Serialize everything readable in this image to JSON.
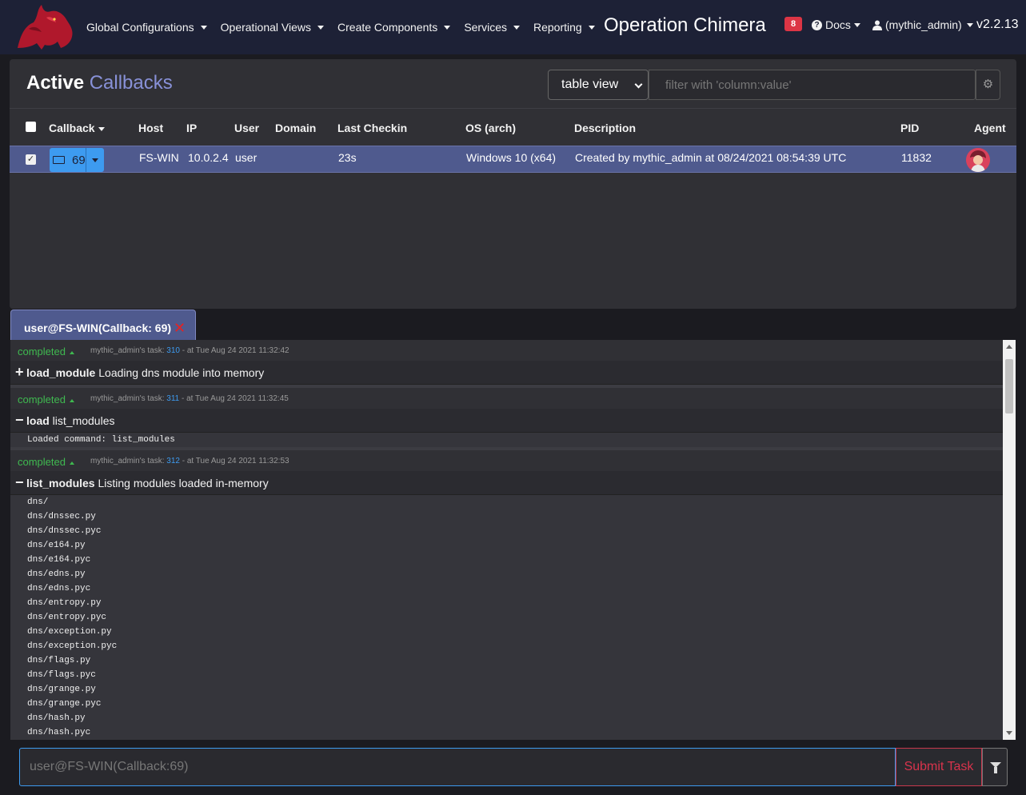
{
  "navbar": {
    "menus": [
      {
        "label": "Global Configurations",
        "name": "nav-global-configurations"
      },
      {
        "label": "Operational Views",
        "name": "nav-operational-views"
      },
      {
        "label": "Create Components",
        "name": "nav-create-components"
      },
      {
        "label": "Services",
        "name": "nav-services"
      },
      {
        "label": "Reporting",
        "name": "nav-reporting"
      }
    ],
    "operation_title": "Operation Chimera",
    "alert_count": "8",
    "docs_label": "Docs",
    "user_label": "(mythic_admin)",
    "version": "v2.2.13"
  },
  "callbacks": {
    "title_prefix": "Active ",
    "title_accent": "Callbacks",
    "view_select": "table view",
    "filter_placeholder": "filter with 'column:value'",
    "columns": [
      "Callback",
      "Host",
      "IP",
      "User",
      "Domain",
      "Last Checkin",
      "OS (arch)",
      "Description",
      "PID",
      "Agent"
    ],
    "rows": [
      {
        "callback_id": "69",
        "host": "FS-WIN",
        "ip": "10.0.2.4",
        "user": "user",
        "domain": "",
        "last_checkin": "23s",
        "os": "Windows 10 (x64)",
        "description": "Created by mythic_admin at 08/24/2021 08:54:39 UTC",
        "pid": "11832",
        "selected": true
      }
    ]
  },
  "tab": {
    "label": "user@FS-WIN(Callback: 69)",
    "close": "✕"
  },
  "tasks": [
    {
      "status": "completed",
      "meta_prefix": "mythic_admin's task: ",
      "task_id": "310",
      "meta_suffix": " - at Tue Aug 24 2021 11:32:42",
      "expand_sign": "+",
      "command": "load_module",
      "params": " Loading dns module into memory",
      "response": []
    },
    {
      "status": "completed",
      "meta_prefix": "mythic_admin's task: ",
      "task_id": "311",
      "meta_suffix": " - at Tue Aug 24 2021 11:32:45",
      "expand_sign": "−",
      "command": "load",
      "params": " list_modules",
      "response": [
        "Loaded command: list_modules"
      ]
    },
    {
      "status": "completed",
      "meta_prefix": "mythic_admin's task: ",
      "task_id": "312",
      "meta_suffix": " - at Tue Aug 24 2021 11:32:53",
      "expand_sign": "−",
      "command": "list_modules",
      "params": " Listing modules loaded in-memory",
      "response": [
        "dns/",
        "dns/dnssec.py",
        "dns/dnssec.pyc",
        "dns/e164.py",
        "dns/e164.pyc",
        "dns/edns.py",
        "dns/edns.pyc",
        "dns/entropy.py",
        "dns/entropy.pyc",
        "dns/exception.py",
        "dns/exception.pyc",
        "dns/flags.py",
        "dns/flags.pyc",
        "dns/grange.py",
        "dns/grange.pyc",
        "dns/hash.py",
        "dns/hash.pyc"
      ]
    }
  ],
  "command_bar": {
    "placeholder": "user@FS-WIN(Callback:69)",
    "submit_label": "Submit Task"
  },
  "colors": {
    "navbar_bg": "#1d2136",
    "accent": "#8891d8",
    "selected_row": "#4f5a8e",
    "status_completed": "#3fb950",
    "task_id_link": "#3d9bf0",
    "danger": "#dc3545"
  }
}
